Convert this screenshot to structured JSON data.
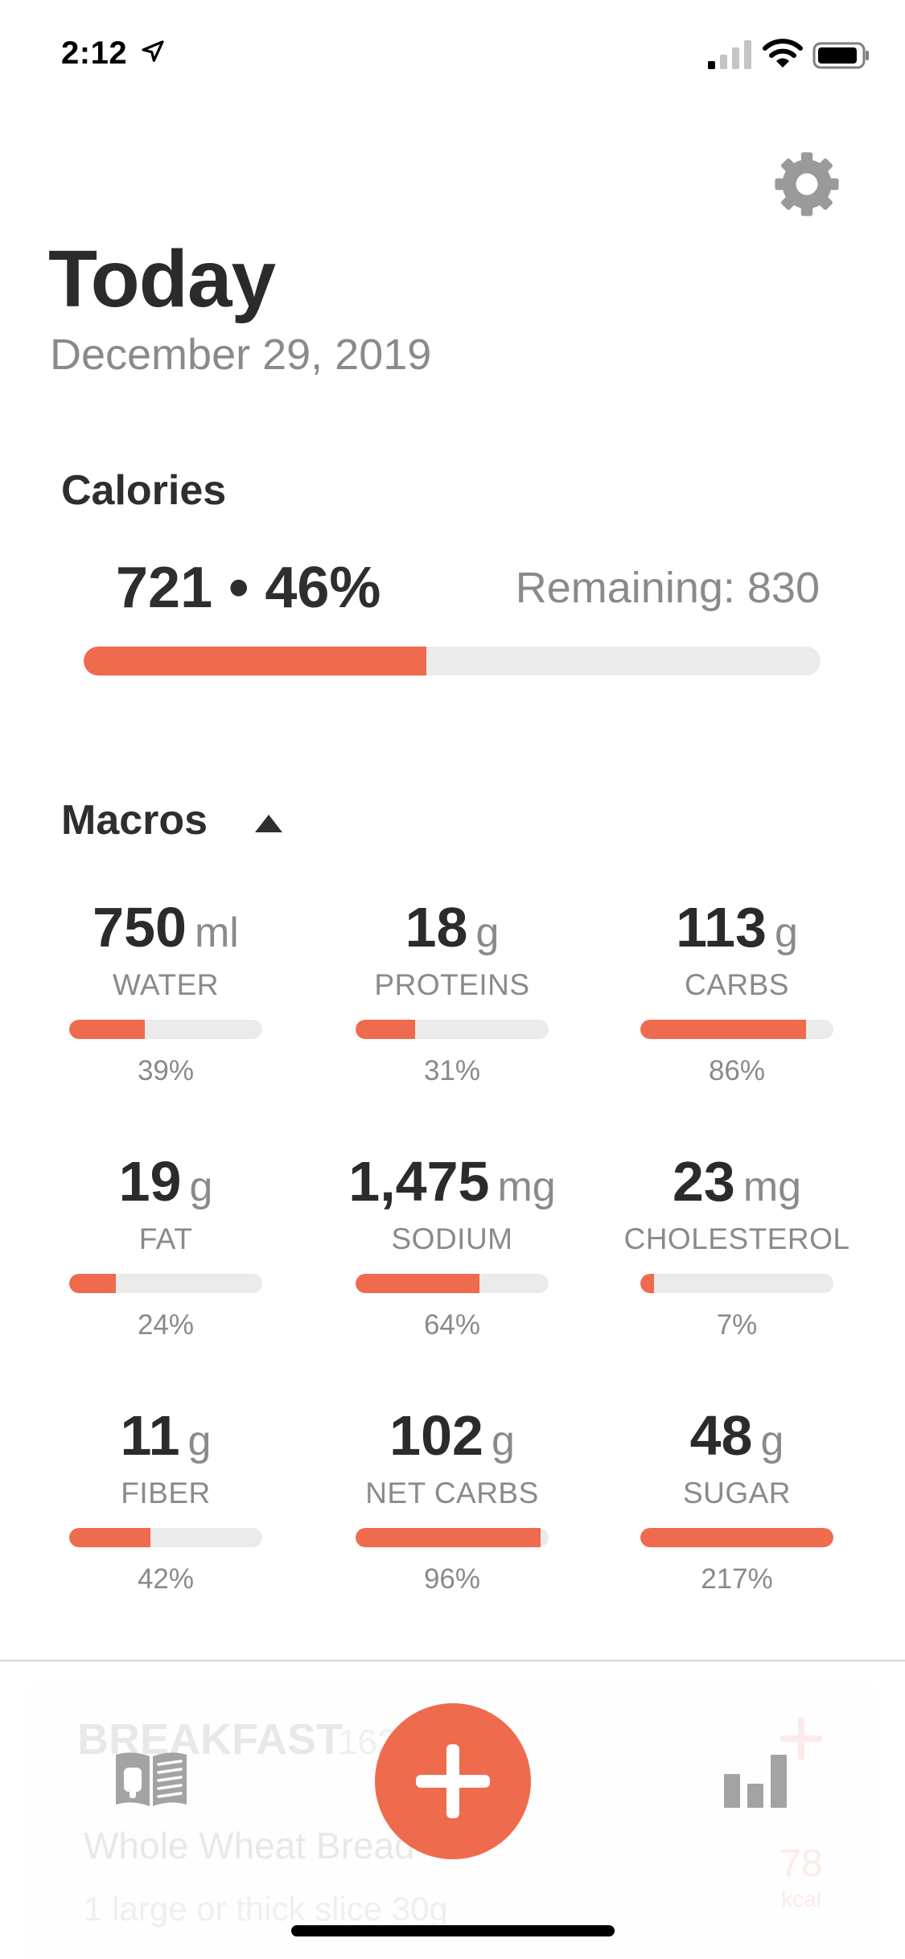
{
  "status_bar": {
    "time": "2:12",
    "icons": [
      "location-arrow-icon",
      "cellular-signal-icon",
      "wifi-icon",
      "battery-icon"
    ]
  },
  "header": {
    "title": "Today",
    "date": "December 29, 2019",
    "settings_icon": "gear-icon"
  },
  "calories": {
    "heading": "Calories",
    "summary": "721 • 46%",
    "remaining": "Remaining: 830",
    "progress": 0.465
  },
  "macros": {
    "heading": "Macros",
    "toggle_icon": "triangle-up-icon",
    "items": [
      {
        "value": "750",
        "unit": "ml",
        "name": "WATER",
        "percent": "39%",
        "progress": 0.39
      },
      {
        "value": "18",
        "unit": "g",
        "name": "PROTEINS",
        "percent": "31%",
        "progress": 0.31
      },
      {
        "value": "113",
        "unit": "g",
        "name": "CARBS",
        "percent": "86%",
        "progress": 0.86
      },
      {
        "value": "19",
        "unit": "g",
        "name": "FAT",
        "percent": "24%",
        "progress": 0.24
      },
      {
        "value": "1,475",
        "unit": "mg",
        "name": "SODIUM",
        "percent": "64%",
        "progress": 0.64
      },
      {
        "value": "23",
        "unit": "mg",
        "name": "CHOLESTEROL",
        "percent": "7%",
        "progress": 0.07
      },
      {
        "value": "11",
        "unit": "g",
        "name": "FIBER",
        "percent": "42%",
        "progress": 0.42
      },
      {
        "value": "102",
        "unit": "g",
        "name": "NET CARBS",
        "percent": "96%",
        "progress": 0.96
      },
      {
        "value": "48",
        "unit": "g",
        "name": "SUGAR",
        "percent": "217%",
        "progress": 1.0
      }
    ]
  },
  "background_card": {
    "meal": "BREAKFAST",
    "meal_calories": "162",
    "food": "Whole Wheat Bread",
    "portion": "1 large or thick slice 30g",
    "kcal_value": "78",
    "kcal_unit": "kcal"
  },
  "tab_bar": {
    "left_icon": "diary-book-icon",
    "center_icon": "plus-icon",
    "right_icon": "bar-chart-icon"
  },
  "colors": {
    "accent": "#ef6b4e",
    "track": "#ebebeb",
    "text_primary": "#2b2b2b",
    "text_secondary": "#8a8a8a"
  }
}
